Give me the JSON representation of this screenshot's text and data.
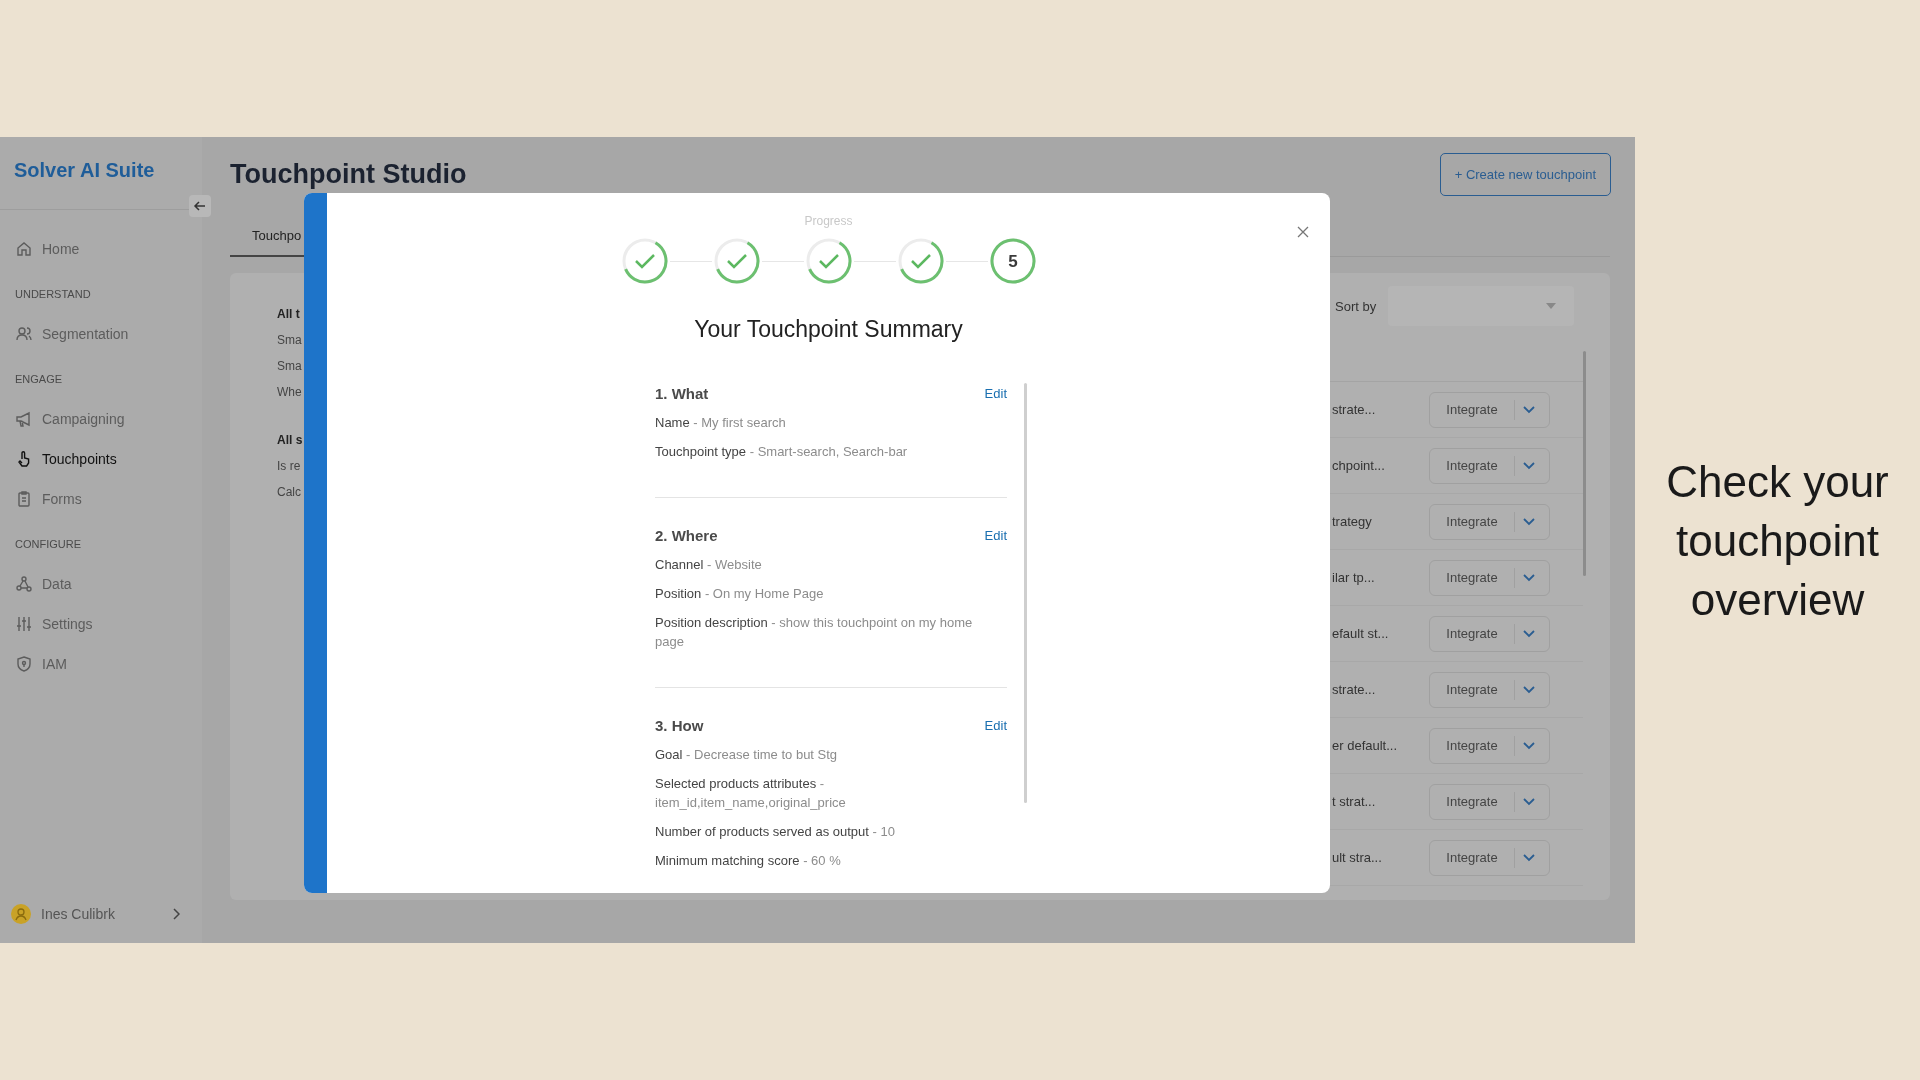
{
  "app": {
    "sidebar": {
      "brand": "Solver AI Suite",
      "items": [
        {
          "kind": "link",
          "label": "Home",
          "selected": false
        },
        {
          "kind": "heading",
          "label": "UNDERSTAND"
        },
        {
          "kind": "link",
          "label": "Segmentation",
          "selected": false
        },
        {
          "kind": "heading",
          "label": "ENGAGE"
        },
        {
          "kind": "link",
          "label": "Campaigning",
          "selected": false
        },
        {
          "kind": "link",
          "label": "Touchpoints",
          "selected": true
        },
        {
          "kind": "link",
          "label": "Forms",
          "selected": false
        },
        {
          "kind": "heading",
          "label": "CONFIGURE"
        },
        {
          "kind": "link",
          "label": "Data",
          "selected": false
        },
        {
          "kind": "link",
          "label": "Settings",
          "selected": false
        },
        {
          "kind": "link",
          "label": "IAM",
          "selected": false
        }
      ],
      "user": {
        "name": "Ines Culibrk"
      }
    },
    "header": {
      "title": "Touchpoint Studio",
      "create_button": "+ Create new touchpoint"
    },
    "tabs": [
      {
        "label": "Touchpo",
        "selected": true
      }
    ],
    "filters": [
      {
        "kind": "heading",
        "label": "All t"
      },
      {
        "kind": "option",
        "label": "Sma"
      },
      {
        "kind": "option",
        "label": "Sma"
      },
      {
        "kind": "option",
        "label": "Whe"
      },
      {
        "kind": "heading",
        "label": "All s"
      },
      {
        "kind": "option",
        "label": "Is re"
      },
      {
        "kind": "option",
        "label": "Calc"
      }
    ],
    "sort": {
      "label": "Sort by"
    },
    "rows": [
      {
        "name": "strate...",
        "action": "Integrate"
      },
      {
        "name": "chpoint...",
        "action": "Integrate"
      },
      {
        "name": "trategy",
        "action": "Integrate"
      },
      {
        "name": "ilar tp...",
        "action": "Integrate"
      },
      {
        "name": "efault st...",
        "action": "Integrate"
      },
      {
        "name": "strate...",
        "action": "Integrate"
      },
      {
        "name": "er default...",
        "action": "Integrate"
      },
      {
        "name": "t strat...",
        "action": "Integrate"
      },
      {
        "name": "ult stra...",
        "action": "Integrate"
      }
    ],
    "modal": {
      "progress_label": "Progress",
      "steps": [
        {
          "kind": "done"
        },
        {
          "kind": "done"
        },
        {
          "kind": "done"
        },
        {
          "kind": "done"
        },
        {
          "kind": "current",
          "label": "5"
        }
      ],
      "title": "Your Touchpoint Summary",
      "sections": [
        {
          "title": "1. What",
          "edit": "Edit",
          "fields": [
            {
              "label": "Name",
              "value": "- My first search"
            },
            {
              "label": "Touchpoint type",
              "value": "- Smart-search, Search-bar"
            }
          ]
        },
        {
          "title": "2. Where",
          "edit": "Edit",
          "fields": [
            {
              "label": "Channel",
              "value": "- Website"
            },
            {
              "label": "Position",
              "value": "- On my Home Page"
            },
            {
              "label": "Position description",
              "value": "- show this touchpoint on my home page"
            }
          ]
        },
        {
          "title": "3. How",
          "edit": "Edit",
          "fields": [
            {
              "label": "Goal",
              "value": "- Decrease time to but Stg"
            },
            {
              "label": "Selected products attributes",
              "value": "- item_id,item_name,original_price"
            },
            {
              "label": "Number of products served as output",
              "value": "- 10"
            },
            {
              "label": "Minimum matching score",
              "value": "- 60 %"
            }
          ]
        }
      ]
    }
  },
  "caption": "Check your touchpoint overview"
}
